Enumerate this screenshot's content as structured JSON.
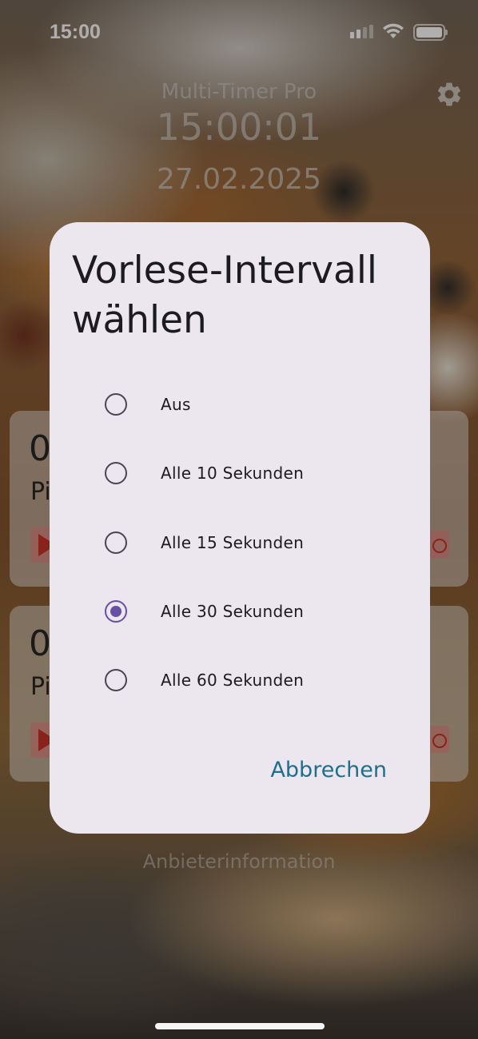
{
  "status_bar": {
    "time": "15:00"
  },
  "header": {
    "app_title": "Multi-Timer Pro",
    "clock": "15:00:01",
    "date": "27.02.2025",
    "settings_icon": "gear-icon"
  },
  "timer_cards": [
    {
      "value_partial": "0",
      "name_partial": "Pi"
    },
    {
      "value_partial": "0",
      "name_partial": "Pi"
    }
  ],
  "footer": {
    "provider_link": "Anbieterinformation"
  },
  "dialog": {
    "title": "Vorlese-Intervall wählen",
    "options": [
      {
        "label": "Aus",
        "selected": false
      },
      {
        "label": "Alle 10 Sekunden",
        "selected": false
      },
      {
        "label": "Alle 15 Sekunden",
        "selected": false
      },
      {
        "label": "Alle 30 Sekunden",
        "selected": true
      },
      {
        "label": "Alle 60 Sekunden",
        "selected": false
      }
    ],
    "cancel_label": "Abbrechen"
  },
  "colors": {
    "dialog_bg": "#ece6ee",
    "radio_selected": "#6750a4",
    "cancel_text": "#1f6e8c"
  }
}
